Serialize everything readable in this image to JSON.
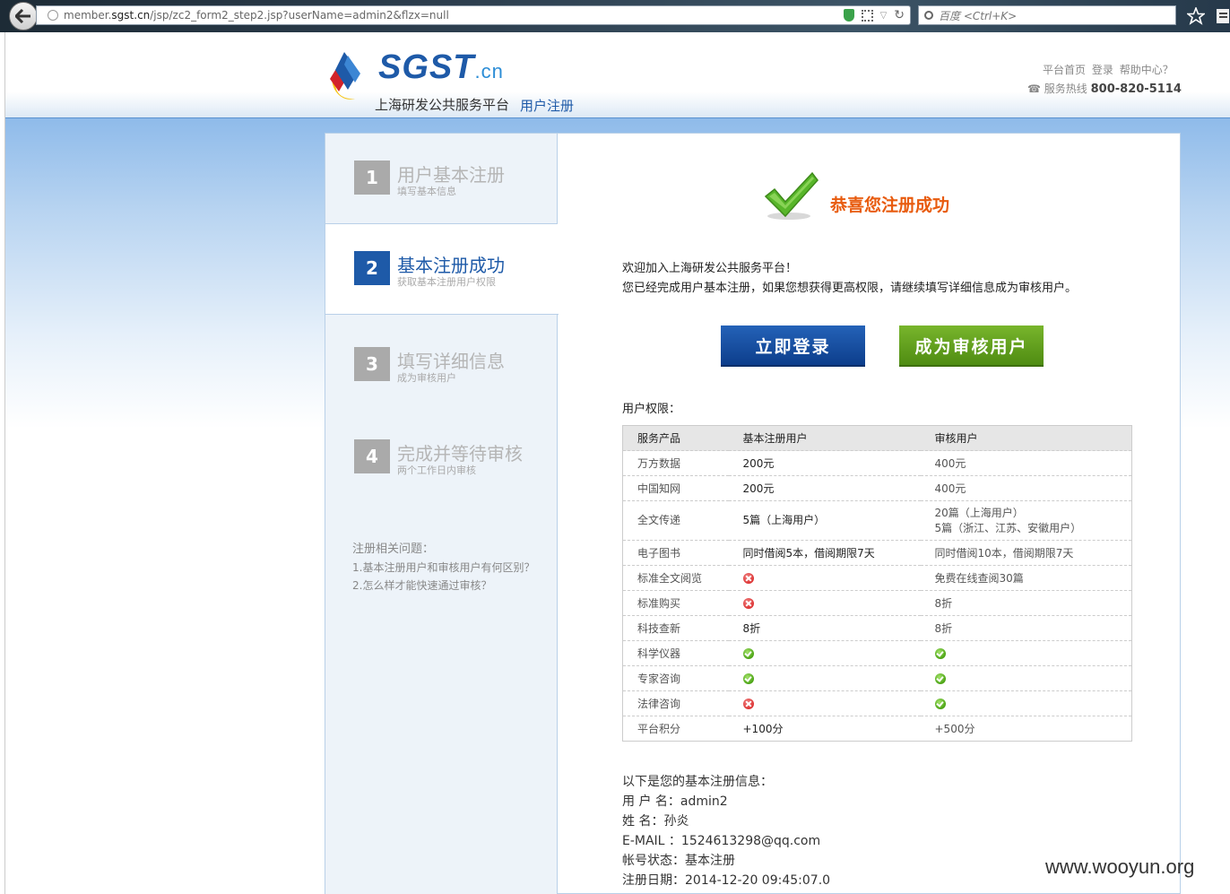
{
  "browser": {
    "url_prefix": "member.",
    "url_domain": "sgst.cn",
    "url_path": "/jsp/zc2_form2_step2.jsp?userName=admin2&flzx=null",
    "search_placeholder": "百度 <Ctrl+K>"
  },
  "header": {
    "logo_main": "SGST",
    "logo_suffix": ".cn",
    "logo_subtitle": "上海研发公共服务平台",
    "section_title": "用户注册",
    "links": [
      "平台首页",
      "登录",
      "帮助中心？"
    ],
    "hotline_label": "服务热线",
    "hotline_number": "800-820-5114"
  },
  "steps": [
    {
      "num": "1",
      "title": "用户基本注册",
      "sub": "填写基本信息"
    },
    {
      "num": "2",
      "title": "基本注册成功",
      "sub": "获取基本注册用户权限"
    },
    {
      "num": "3",
      "title": "填写详细信息",
      "sub": "成为审核用户"
    },
    {
      "num": "4",
      "title": "完成并等待审核",
      "sub": "两个工作日内审核"
    }
  ],
  "faq": {
    "title": "注册相关问题：",
    "items": [
      "1.基本注册用户和审核用户有何区别？",
      "2.怎么样才能快速通过审核？"
    ]
  },
  "success_message": "恭喜您注册成功",
  "welcome": {
    "line1": "欢迎加入上海研发公共服务平台！",
    "line2": "您已经完成用户基本注册，如果您想获得更高权限，请继续填写详细信息成为审核用户。"
  },
  "buttons": {
    "login": "立即登录",
    "audit": "成为审核用户"
  },
  "permissions": {
    "title": "用户权限：",
    "headers": [
      "服务产品",
      "基本注册用户",
      "审核用户"
    ],
    "rows": [
      {
        "product": "万方数据",
        "basic": "200元",
        "audited": "400元"
      },
      {
        "product": "中国知网",
        "basic": "200元",
        "audited": "400元"
      },
      {
        "product": "全文传递",
        "basic": "5篇（上海用户）",
        "audited": "20篇（上海用户）",
        "audited2": "5篇（浙江、江苏、安徽用户）"
      },
      {
        "product": "电子图书",
        "basic": "同时借阅5本，借阅期限7天",
        "audited": "同时借阅10本，借阅期限7天"
      },
      {
        "product": "标准全文阅览",
        "basic_icon": "no",
        "audited": "免费在线查阅30篇"
      },
      {
        "product": "标准购买",
        "basic_icon": "no",
        "audited": "8折"
      },
      {
        "product": "科技查新",
        "basic": "8折",
        "audited": "8折"
      },
      {
        "product": "科学仪器",
        "basic_icon": "yes",
        "audited_icon": "yes"
      },
      {
        "product": "专家咨询",
        "basic_icon": "yes",
        "audited_icon": "yes"
      },
      {
        "product": "法律咨询",
        "basic_icon": "no",
        "audited_icon": "yes"
      },
      {
        "product": "平台积分",
        "basic": "+100分",
        "audited": "+500分"
      }
    ]
  },
  "registration_info": {
    "title": "以下是您的基本注册信息：",
    "username": "用 户 名：admin2",
    "name": "姓 名：孙炎",
    "email": "E-MAIL ：1524613298@qq.com",
    "status": "帐号状态：基本注册",
    "date": "注册日期：2014-12-20 09:45:07.0"
  },
  "watermark": "www.wooyun.org"
}
